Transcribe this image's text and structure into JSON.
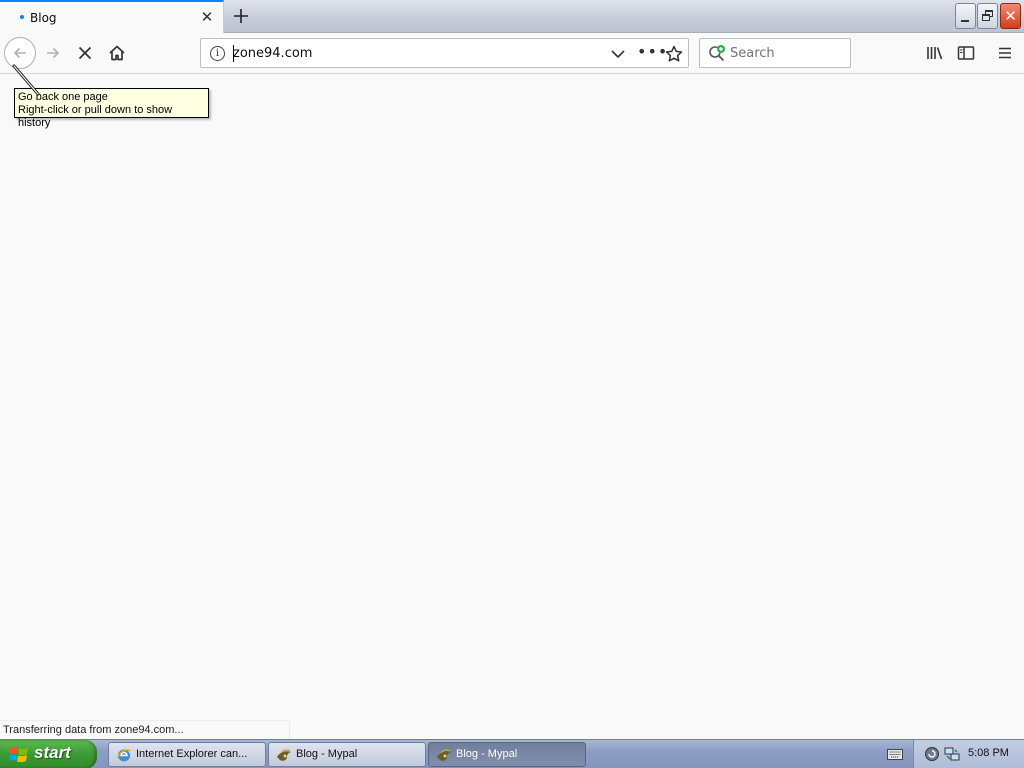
{
  "browser": {
    "tab": {
      "title": "Blog",
      "close_icon": "close-icon"
    },
    "new_tab_icon": "plus-icon",
    "window_controls": [
      "minimize",
      "restore",
      "close"
    ],
    "toolbar": {
      "back_icon": "arrow-left-icon",
      "forward_icon": "arrow-right-icon",
      "stop_icon": "stop-x-icon",
      "home_icon": "home-icon",
      "library_icon": "library-icon",
      "sidebar_icon": "sidebar-icon",
      "menu_icon": "hamburger-menu-icon"
    },
    "url_bar": {
      "info_glyph": "i",
      "url": "zone94.com"
    },
    "search": {
      "placeholder": "Search"
    },
    "tooltip": {
      "line1": "Go back one page",
      "line2": "Right-click or pull down to show history"
    },
    "status_text": "Transferring data from zone94.com...",
    "accent_color": "#0a84ff"
  },
  "taskbar": {
    "start_label": "start",
    "tasks": [
      {
        "label": "Internet Explorer can...",
        "icon": "ie-icon",
        "active": false
      },
      {
        "label": "Blog - Mypal",
        "icon": "mypal-icon",
        "active": false
      },
      {
        "label": "Blog - Mypal",
        "icon": "mypal-icon",
        "active": true
      }
    ],
    "clock": "5:08 PM"
  }
}
